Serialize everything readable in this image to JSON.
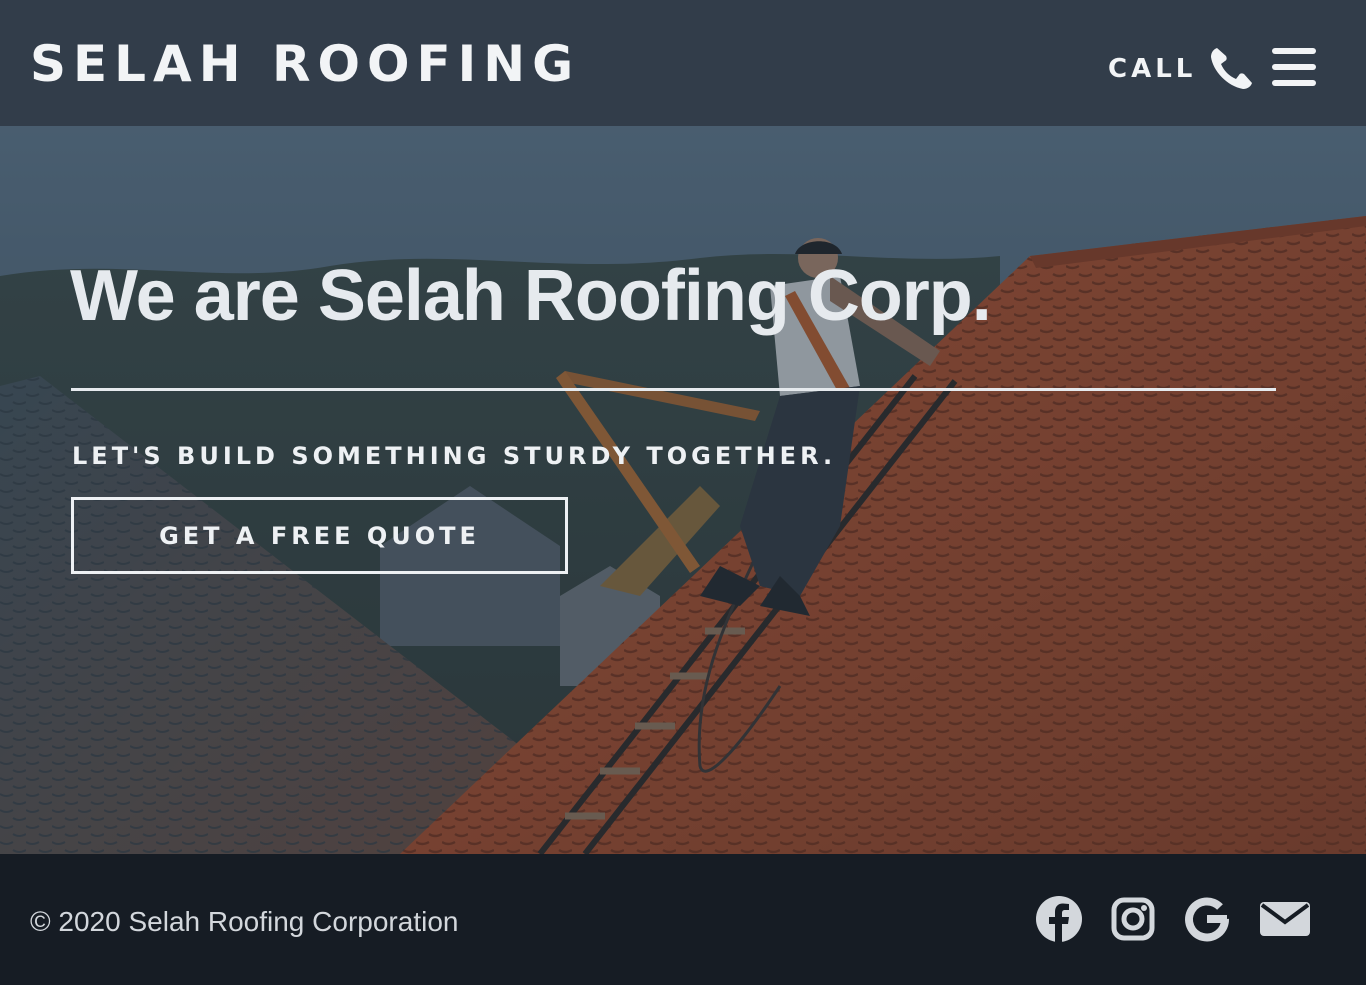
{
  "header": {
    "brand": "SELAH ROOFING",
    "call_label": "CALL",
    "phone_icon": "phone-icon",
    "menu_icon": "hamburger-menu-icon"
  },
  "hero": {
    "title": "We are Selah Roofing Corp.",
    "tagline": "LET'S BUILD SOMETHING STURDY TOGETHER.",
    "cta_label": "GET A FREE QUOTE",
    "background_image": "roofer climbing ladder on orange tiled roof"
  },
  "footer": {
    "copyright": "© 2020 Selah Roofing Corporation",
    "social_icons": [
      "facebook-icon",
      "instagram-icon",
      "google-icon",
      "email-icon"
    ]
  },
  "colors": {
    "header_bg": "#323d4a",
    "footer_bg": "#161c24",
    "text_light": "#f2f4f6",
    "roof_orange": "#b4532e"
  }
}
